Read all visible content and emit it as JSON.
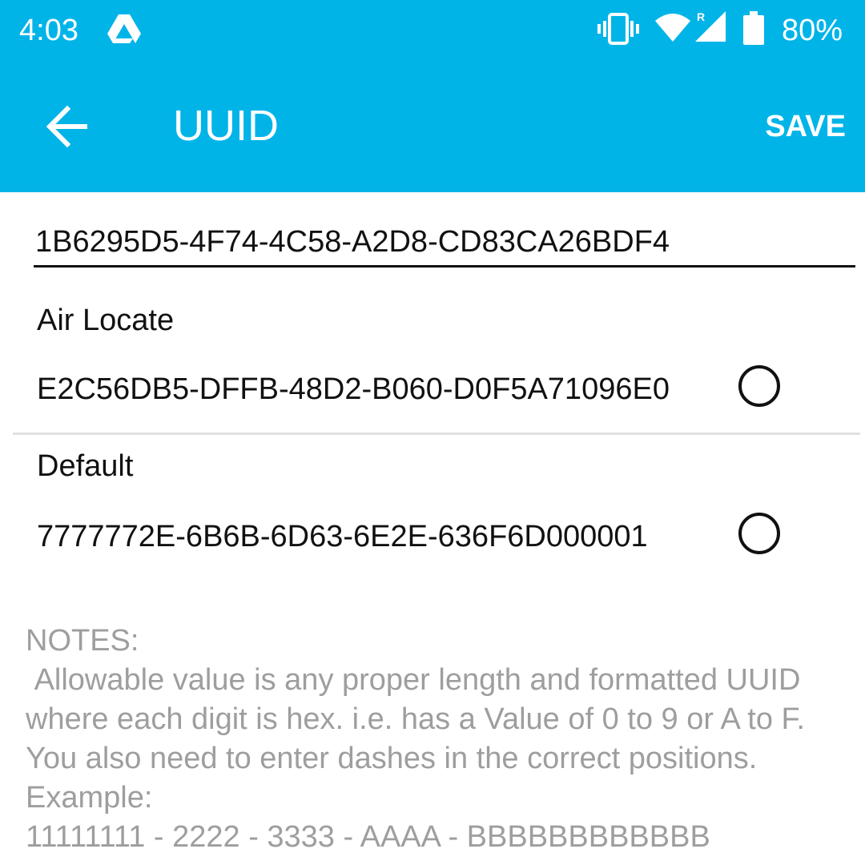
{
  "status_bar": {
    "time": "4:03",
    "battery": "80%",
    "icons": [
      "drive-icon",
      "vibrate-icon",
      "wifi-icon",
      "signal-roaming-icon",
      "battery-icon"
    ]
  },
  "app_bar": {
    "title": "UUID",
    "back_icon": "arrow-back-icon",
    "save_label": "SAVE"
  },
  "uuid_field": {
    "value": "1B6295D5-4F74-4C58-A2D8-CD83CA26BDF4"
  },
  "presets": [
    {
      "label": "Air Locate",
      "uuid": "E2C56DB5-DFFB-48D2-B060-D0F5A71096E0",
      "selected": false
    },
    {
      "label": "Default",
      "uuid": "7777772E-6B6B-6D63-6E2E-636F6D000001",
      "selected": false
    }
  ],
  "notes": {
    "text": "NOTES:\n Allowable value is any proper length and formatted UUID where each digit is hex. i.e. has a Value of 0 to 9 or A to F. You also need to enter dashes in the correct positions.\nExample:\n11111111 - 2222 - 3333 - AAAA - BBBBBBBBBBBB"
  },
  "colors": {
    "accent": "#00b4e8",
    "text": "#111111",
    "notes_text": "#9e9e9e",
    "divider": "#e0e0e0"
  }
}
